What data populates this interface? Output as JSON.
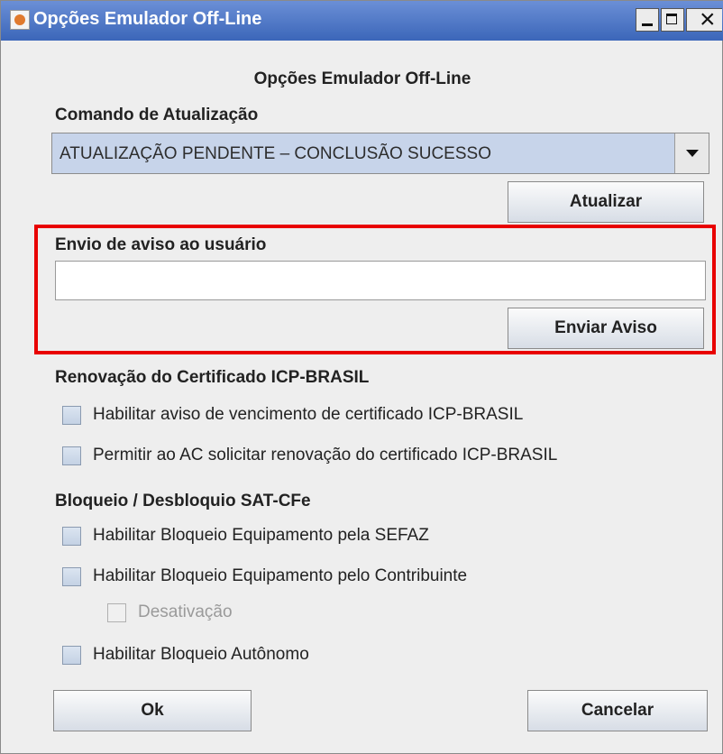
{
  "window": {
    "title": "Opções Emulador Off-Line"
  },
  "dialog": {
    "heading": "Opções Emulador Off-Line"
  },
  "update": {
    "label": "Comando de Atualização",
    "selected": "ATUALIZAÇÃO PENDENTE – CONCLUSÃO SUCESSO",
    "button": "Atualizar"
  },
  "notice": {
    "label": "Envio de aviso ao usuário",
    "value": "",
    "button": "Enviar Aviso"
  },
  "certificate": {
    "label": "Renovação do Certificado ICP-BRASIL",
    "options": [
      {
        "label": "Habilitar aviso de vencimento de certificado ICP-BRASIL",
        "checked": false
      },
      {
        "label": "Permitir ao AC solicitar renovação do certificado ICP-BRASIL",
        "checked": false
      }
    ]
  },
  "block": {
    "label": "Bloqueio / Desbloquio SAT-CFe",
    "options": [
      {
        "label": "Habilitar Bloqueio Equipamento pela SEFAZ",
        "checked": false
      },
      {
        "label": "Habilitar Bloqueio Equipamento pelo Contribuinte",
        "checked": false
      },
      {
        "label": "Desativação",
        "checked": false,
        "disabled": true
      },
      {
        "label": "Habilitar Bloqueio Autônomo",
        "checked": false
      }
    ]
  },
  "footer": {
    "ok": "Ok",
    "cancel": "Cancelar"
  },
  "colors": {
    "titlebar": "#3b66b9",
    "highlight": "#e80000",
    "combo": "#c7d4ea"
  }
}
